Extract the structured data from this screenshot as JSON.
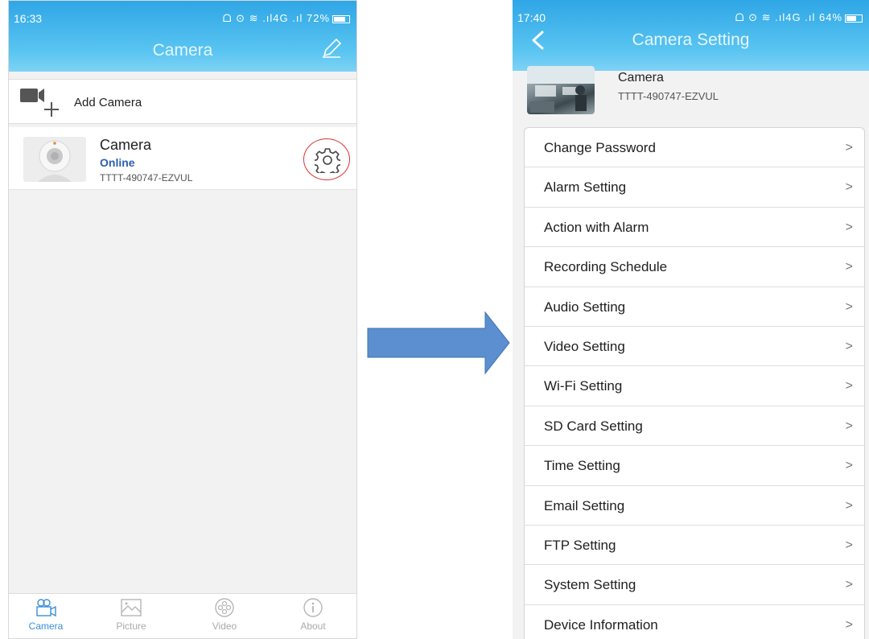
{
  "left_screen": {
    "status": {
      "time": "16:33",
      "icons": "ᗝ ⊙ ≋ .ıl4G .ıl 72%"
    },
    "title": "Camera",
    "add_camera_label": "Add Camera",
    "camera": {
      "name": "Camera",
      "status": "Online",
      "uid": "TTTT-490747-EZVUL"
    },
    "tabs": [
      {
        "label": "Camera",
        "icon": "camera-tab-icon",
        "active": true
      },
      {
        "label": "Picture",
        "icon": "picture-tab-icon",
        "active": false
      },
      {
        "label": "Video",
        "icon": "video-tab-icon",
        "active": false
      },
      {
        "label": "About",
        "icon": "about-tab-icon",
        "active": false
      }
    ]
  },
  "right_screen": {
    "status": {
      "time": "17:40",
      "icons": "ᗝ ⊙ ≋ .ıl4G .ıl 64%"
    },
    "title": "Camera Setting",
    "device": {
      "name": "Camera",
      "uid": "TTTT-490747-EZVUL"
    },
    "menu": [
      "Change Password",
      "Alarm Setting",
      "Action with Alarm",
      "Recording Schedule",
      "Audio Setting",
      "Video Setting",
      "Wi-Fi Setting",
      "SD Card Setting",
      "Time Setting",
      "Email Setting",
      "FTP Setting",
      "System Setting",
      "Device Information"
    ],
    "chevron": ">"
  },
  "colors": {
    "header": "#58c4f1",
    "arrow": "#5b8fd0",
    "online": "#2a5fb0",
    "tab_active": "#3a8fd8"
  },
  "battery": {
    "left": 0.72,
    "right": 0.64
  }
}
